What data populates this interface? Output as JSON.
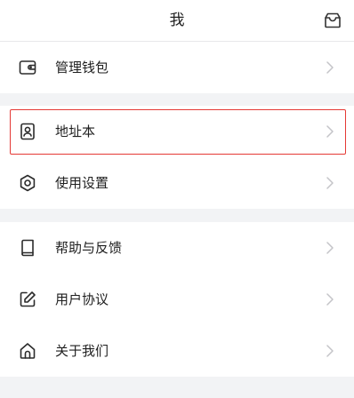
{
  "header": {
    "title": "我",
    "inbox_icon": "inbox-icon"
  },
  "menu": {
    "group1": [
      {
        "label": "管理钱包",
        "icon": "wallet-icon"
      }
    ],
    "group2": [
      {
        "label": "地址本",
        "icon": "address-book-icon",
        "highlighted": true
      },
      {
        "label": "使用设置",
        "icon": "gear-icon"
      }
    ],
    "group3": [
      {
        "label": "帮助与反馈",
        "icon": "book-icon"
      },
      {
        "label": "用户协议",
        "icon": "edit-icon"
      },
      {
        "label": "关于我们",
        "icon": "home-icon"
      }
    ]
  },
  "colors": {
    "background": "#f2f3f5",
    "card": "#ffffff",
    "highlight_border": "#e53935",
    "chevron": "#c4c4c8"
  }
}
